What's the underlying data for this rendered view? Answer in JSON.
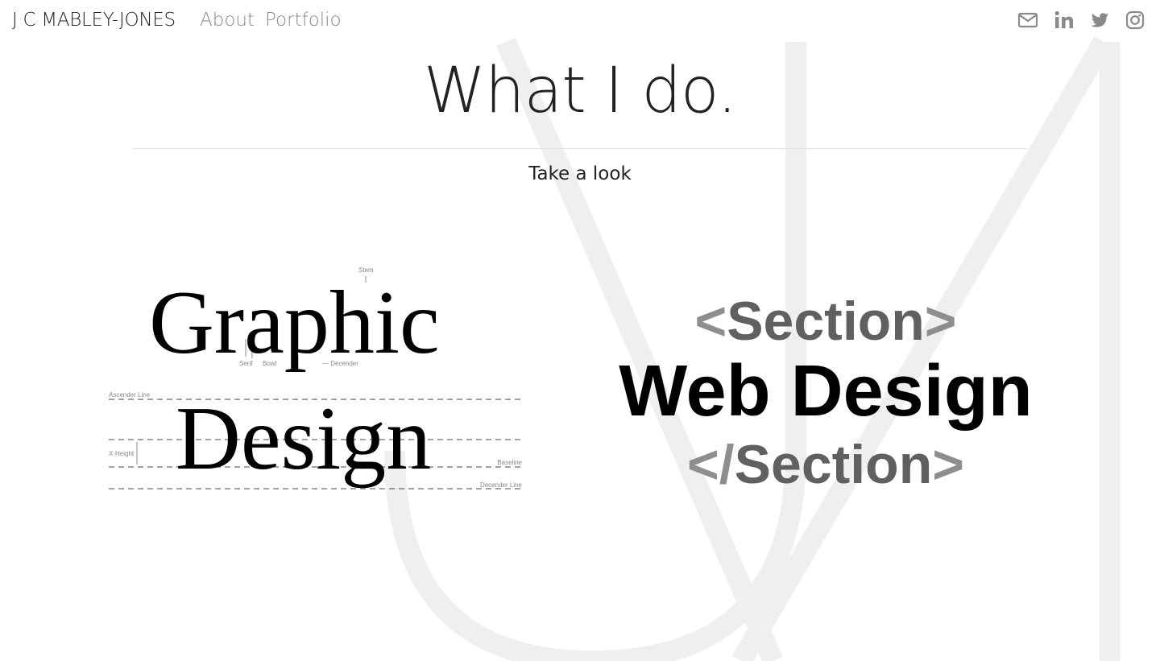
{
  "nav": {
    "brand": "J C MABLEY-JONES",
    "links": [
      "About",
      "Portfolio"
    ],
    "social_icons": [
      "envelope-icon",
      "linkedin-icon",
      "twitter-icon",
      "instagram-icon"
    ]
  },
  "hero": {
    "title": "What I do.",
    "subtitle": "Take a look"
  },
  "graphic_design": {
    "line1": "Graphic",
    "line2": "Design",
    "annotations": {
      "stem": "Stem",
      "serif": "Serif",
      "bowl": "Bowl",
      "descender": "— Decender",
      "ascender_line": "Ascender Line",
      "x_height": "X-Height",
      "baseline": "Baseline",
      "descender_line": "Decender Line"
    }
  },
  "web_design": {
    "open_bracket_left": "<",
    "open_word": "Section",
    "open_bracket_right": ">",
    "main": "Web Design",
    "close_bracket_left": "</",
    "close_word": "Section",
    "close_bracket_right": ">"
  },
  "colors": {
    "background": "#ffffff",
    "text": "#222222",
    "nav_link": "#8a8a8a",
    "watermark": "#eeeeee",
    "bracket": "#8e8e8e",
    "section_word": "#606060"
  }
}
